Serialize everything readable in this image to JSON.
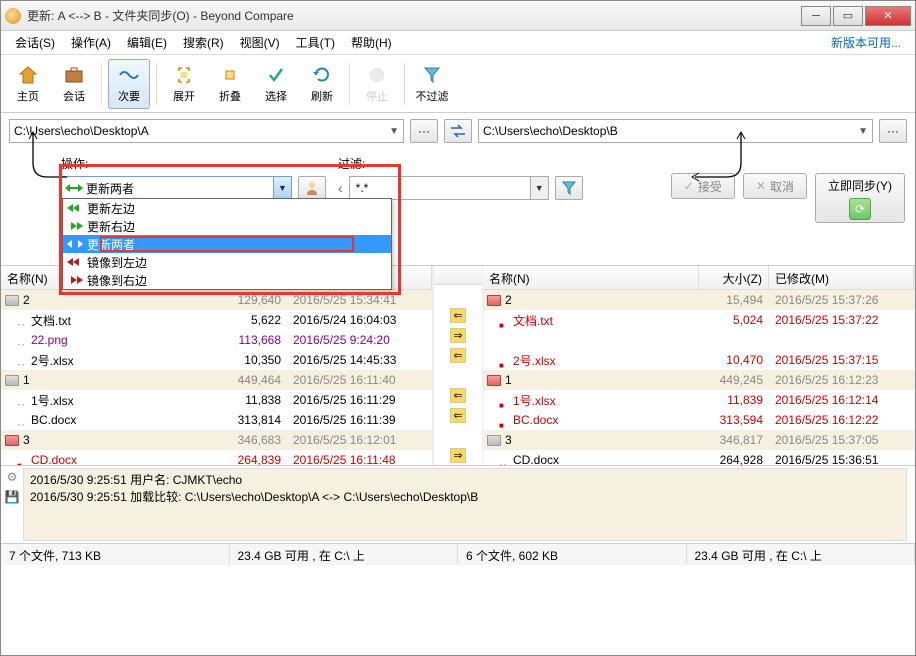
{
  "window": {
    "title": "更新: A <--> B - 文件夹同步(O) - Beyond Compare"
  },
  "menu": {
    "session": "会话(S)",
    "action": "操作(A)",
    "edit": "编辑(E)",
    "search": "搜索(R)",
    "view": "视图(V)",
    "tools": "工具(T)",
    "help": "帮助(H)",
    "newver": "新版本可用..."
  },
  "toolbar": {
    "home": "主页",
    "session_btn": "会话",
    "minor": "次要",
    "expand": "展开",
    "collapse": "折叠",
    "select": "选择",
    "refresh": "刷新",
    "stop": "停止",
    "nofilter": "不过滤"
  },
  "paths": {
    "left": "C:\\Users\\echo\\Desktop\\A",
    "right": "C:\\Users\\echo\\Desktop\\B"
  },
  "controls": {
    "op_label": "操作:",
    "filter_label": "过滤:",
    "selected_op": "更新两者",
    "filter_value": "*.*",
    "options": [
      "更新左边",
      "更新右边",
      "更新两者",
      "镜像到左边",
      "镜像到右边"
    ],
    "accept": "接受",
    "cancel": "取消",
    "sync": "立即同步(Y)"
  },
  "cols": {
    "name": "名称(N)",
    "size": "大小(Z)",
    "mod": "已修改(M)"
  },
  "left_rows": [
    {
      "type": "folder",
      "color": "gray",
      "name": "2",
      "size": "129,640",
      "mod": "2016/5/25 15:34:41"
    },
    {
      "type": "file",
      "indent": 1,
      "name": "文档.txt",
      "size": "5,622",
      "mod": "2016/5/24 16:04:03"
    },
    {
      "type": "file",
      "indent": 1,
      "name": "22.png",
      "cls": "purple-txt",
      "size": "113,668",
      "mod": "2016/5/25 9:24:20",
      "smod": "purple-txt",
      "ssize": "purple-txt"
    },
    {
      "type": "file",
      "indent": 1,
      "name": "2号.xlsx",
      "size": "10,350",
      "mod": "2016/5/25 14:45:33"
    },
    {
      "type": "folder",
      "color": "gray",
      "name": "1",
      "size": "449,464",
      "mod": "2016/5/25 16:11:40"
    },
    {
      "type": "file",
      "indent": 1,
      "name": "1号.xlsx",
      "size": "11,838",
      "mod": "2016/5/25 16:11:29"
    },
    {
      "type": "file",
      "indent": 1,
      "name": "BC.docx",
      "size": "313,814",
      "mod": "2016/5/25 16:11:39"
    },
    {
      "type": "folder",
      "color": "red",
      "name": "3",
      "size": "346,683",
      "mod": "2016/5/25 16:12:01"
    },
    {
      "type": "file",
      "indent": 1,
      "mark": "red",
      "name": "CD.docx",
      "cls": "red-txt",
      "size": "264,839",
      "mod": "2016/5/25 16:11:48",
      "smod": "red-txt",
      "ssize": "red-txt"
    }
  ],
  "right_rows": [
    {
      "type": "folder",
      "color": "red",
      "name": "2",
      "size": "15,494",
      "mod": "2016/5/25 15:37:26"
    },
    {
      "type": "file",
      "indent": 1,
      "mark": "red",
      "name": "文档.txt",
      "cls": "red-txt",
      "size": "5,024",
      "mod": "2016/5/25 15:37:22",
      "smod": "red-txt",
      "ssize": "red-txt"
    },
    {
      "type": "blank"
    },
    {
      "type": "file",
      "indent": 1,
      "mark": "red",
      "name": "2号.xlsx",
      "cls": "red-txt",
      "size": "10,470",
      "mod": "2016/5/25 15:37:15",
      "smod": "red-txt",
      "ssize": "red-txt"
    },
    {
      "type": "folder",
      "color": "red",
      "name": "1",
      "size": "449,245",
      "mod": "2016/5/25 16:12:23"
    },
    {
      "type": "file",
      "indent": 1,
      "mark": "red",
      "name": "1号.xlsx",
      "cls": "red-txt",
      "size": "11,839",
      "mod": "2016/5/25 16:12:14",
      "smod": "red-txt",
      "ssize": "red-txt"
    },
    {
      "type": "file",
      "indent": 1,
      "mark": "red",
      "name": "BC.docx",
      "cls": "red-txt",
      "size": "313,594",
      "mod": "2016/5/25 16:12:22",
      "smod": "red-txt",
      "ssize": "red-txt"
    },
    {
      "type": "folder",
      "color": "gray",
      "name": "3",
      "size": "346,817",
      "mod": "2016/5/25 15:37:05"
    },
    {
      "type": "file",
      "indent": 1,
      "name": "CD.docx",
      "size": "264,928",
      "mod": "2016/5/25 15:36:51"
    }
  ],
  "actions": [
    "",
    "⇐",
    "⇒",
    "⇐",
    "",
    "⇐",
    "⇐",
    "",
    "⇒"
  ],
  "log": {
    "l1": "2016/5/30 9:25:51   用户名: CJMKT\\echo",
    "l2": "2016/5/30 9:25:51   加载比较: C:\\Users\\echo\\Desktop\\A <-> C:\\Users\\echo\\Desktop\\B"
  },
  "status": {
    "s1": "7 个文件, 713 KB",
    "s2": "23.4 GB 可用 , 在 C:\\ 上",
    "s3": "6 个文件, 602 KB",
    "s4": "23.4 GB 可用 , 在 C:\\ 上"
  }
}
